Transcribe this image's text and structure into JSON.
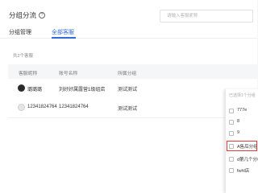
{
  "header": {
    "title": "分组分流"
  },
  "search": {
    "placeholder": "请输入客服昵称"
  },
  "tabs": [
    {
      "label": "分组管理",
      "active": false
    },
    {
      "label": "全部客服",
      "active": true
    }
  ],
  "summary": {
    "count_text": "共2个客服"
  },
  "table": {
    "columns": [
      "客服昵称",
      "账号名称",
      "所属分组"
    ],
    "rows": [
      {
        "nickname": "璐璐璐",
        "account": "刘好好属露营1级组店",
        "group": "测试测试",
        "avatar": "dark"
      },
      {
        "nickname": "12341824764",
        "account": "12341824764",
        "group": "测试测试",
        "avatar": "light"
      }
    ]
  },
  "dropdown": {
    "header": "已选择1个分组",
    "items": [
      {
        "label": "777e",
        "checked": false
      },
      {
        "label": "8",
        "checked": false
      },
      {
        "label": "9",
        "checked": false
      },
      {
        "label": "A售后分组",
        "checked": false,
        "highlighted": true
      },
      {
        "label": "d第几个分组",
        "checked": false
      },
      {
        "label": "fwhl店",
        "checked": false
      }
    ]
  },
  "colors": {
    "accent": "#2f6bdc",
    "highlight": "#e53935"
  }
}
